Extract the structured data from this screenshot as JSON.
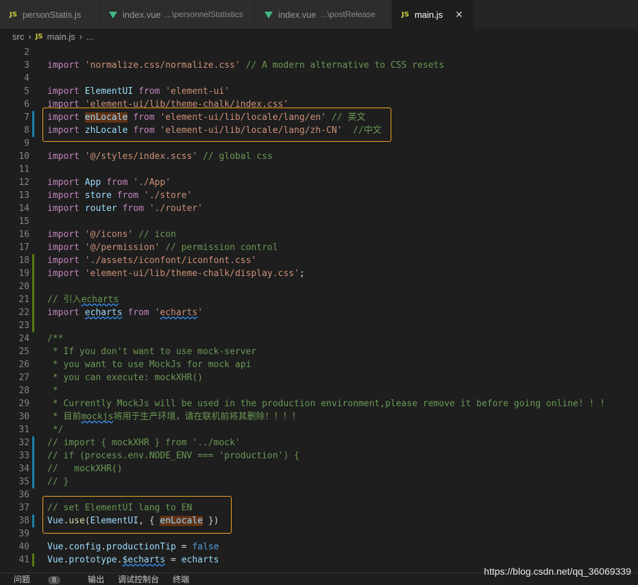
{
  "tabs": [
    {
      "label": "personStatis.js",
      "badge": "JS",
      "path": "",
      "active": false
    },
    {
      "label": "index.vue",
      "badge": "vue",
      "path": "...\\personnelStatistics",
      "active": false
    },
    {
      "label": "index.vue",
      "badge": "vue",
      "path": "...\\postRelease",
      "active": false
    },
    {
      "label": "main.js",
      "badge": "JS",
      "path": "",
      "active": true,
      "close": "✕"
    }
  ],
  "breadcrumb": {
    "folder": "src",
    "file_badge": "JS",
    "file": "main.js",
    "more": "..."
  },
  "lines": [
    {
      "n": "2",
      "mark": "",
      "parts": []
    },
    {
      "n": "3",
      "mark": "",
      "parts": [
        [
          "kw",
          "import "
        ],
        [
          "str",
          "'normalize.css/normalize.css'"
        ],
        [
          "op",
          " "
        ],
        [
          "cm",
          "// A modern alternative to CSS resets"
        ]
      ]
    },
    {
      "n": "4",
      "mark": "",
      "parts": []
    },
    {
      "n": "5",
      "mark": "",
      "parts": [
        [
          "kw",
          "import "
        ],
        [
          "var",
          "ElementUI"
        ],
        [
          "kw",
          " from "
        ],
        [
          "str",
          "'element-ui'"
        ]
      ]
    },
    {
      "n": "6",
      "mark": "",
      "parts": [
        [
          "kw",
          "import "
        ],
        [
          "str",
          "'element-ui/lib/theme-chalk/index.css'"
        ]
      ]
    },
    {
      "n": "7",
      "mark": "mod",
      "parts": [
        [
          "kw",
          "import "
        ],
        [
          "var hl",
          "enLocale"
        ],
        [
          "kw",
          " from "
        ],
        [
          "str",
          "'element-ui/lib/locale/lang/en'"
        ],
        [
          "op",
          " "
        ],
        [
          "cm",
          "// 英文"
        ]
      ]
    },
    {
      "n": "8",
      "mark": "mod",
      "parts": [
        [
          "kw",
          "import "
        ],
        [
          "var",
          "zhLocale"
        ],
        [
          "kw",
          " from "
        ],
        [
          "str",
          "'element-ui/lib/locale/lang/zh-CN'"
        ],
        [
          "op",
          "  "
        ],
        [
          "cm",
          "//中文"
        ]
      ]
    },
    {
      "n": "9",
      "mark": "",
      "parts": []
    },
    {
      "n": "10",
      "mark": "",
      "parts": [
        [
          "kw",
          "import "
        ],
        [
          "str",
          "'@/styles/index.scss'"
        ],
        [
          "op",
          " "
        ],
        [
          "cm",
          "// global css"
        ]
      ]
    },
    {
      "n": "11",
      "mark": "",
      "parts": []
    },
    {
      "n": "12",
      "mark": "",
      "parts": [
        [
          "kw",
          "import "
        ],
        [
          "var",
          "App"
        ],
        [
          "kw",
          " from "
        ],
        [
          "str",
          "'./App'"
        ]
      ]
    },
    {
      "n": "13",
      "mark": "",
      "parts": [
        [
          "kw",
          "import "
        ],
        [
          "var",
          "store"
        ],
        [
          "kw",
          " from "
        ],
        [
          "str",
          "'./store'"
        ]
      ]
    },
    {
      "n": "14",
      "mark": "",
      "parts": [
        [
          "kw",
          "import "
        ],
        [
          "var",
          "router"
        ],
        [
          "kw",
          " from "
        ],
        [
          "str",
          "'./router'"
        ]
      ]
    },
    {
      "n": "15",
      "mark": "",
      "parts": []
    },
    {
      "n": "16",
      "mark": "",
      "parts": [
        [
          "kw",
          "import "
        ],
        [
          "str",
          "'@/icons'"
        ],
        [
          "op",
          " "
        ],
        [
          "cm",
          "// icon"
        ]
      ]
    },
    {
      "n": "17",
      "mark": "",
      "parts": [
        [
          "kw",
          "import "
        ],
        [
          "str",
          "'@/permission'"
        ],
        [
          "op",
          " "
        ],
        [
          "cm",
          "// permission control"
        ]
      ]
    },
    {
      "n": "18",
      "mark": "add",
      "parts": [
        [
          "kw",
          "import "
        ],
        [
          "str",
          "'./assets/iconfont/iconfont.css'"
        ]
      ]
    },
    {
      "n": "19",
      "mark": "add",
      "parts": [
        [
          "kw",
          "import "
        ],
        [
          "str",
          "'element-ui/lib/theme-chalk/display.css'"
        ],
        [
          "op",
          ";"
        ]
      ]
    },
    {
      "n": "20",
      "mark": "add",
      "parts": []
    },
    {
      "n": "21",
      "mark": "add",
      "parts": [
        [
          "cm",
          "// 引入"
        ],
        [
          "cm squig",
          "echarts"
        ]
      ]
    },
    {
      "n": "22",
      "mark": "add",
      "parts": [
        [
          "kw",
          "import "
        ],
        [
          "var squig",
          "echarts"
        ],
        [
          "kw",
          " from "
        ],
        [
          "str",
          "'"
        ],
        [
          "str squig",
          "echarts"
        ],
        [
          "str",
          "'"
        ]
      ]
    },
    {
      "n": "23",
      "mark": "add",
      "parts": []
    },
    {
      "n": "24",
      "mark": "",
      "parts": [
        [
          "cm",
          "/**"
        ]
      ]
    },
    {
      "n": "25",
      "mark": "",
      "parts": [
        [
          "cm",
          " * If you don't want to use mock-server"
        ]
      ]
    },
    {
      "n": "26",
      "mark": "",
      "parts": [
        [
          "cm",
          " * you want to use MockJs for mock api"
        ]
      ]
    },
    {
      "n": "27",
      "mark": "",
      "parts": [
        [
          "cm",
          " * you can execute: mockXHR()"
        ]
      ]
    },
    {
      "n": "28",
      "mark": "",
      "parts": [
        [
          "cm",
          " *"
        ]
      ]
    },
    {
      "n": "29",
      "mark": "",
      "parts": [
        [
          "cm",
          " * Currently MockJs will be used in the production environment,please remove it before going online! ! !"
        ]
      ]
    },
    {
      "n": "30",
      "mark": "",
      "parts": [
        [
          "cm",
          " * 目前"
        ],
        [
          "cm squig",
          "mockjs"
        ],
        [
          "cm",
          "将用于生产环境，请在联机前将其删除！！！！"
        ]
      ]
    },
    {
      "n": "31",
      "mark": "",
      "parts": [
        [
          "cm",
          " */"
        ]
      ]
    },
    {
      "n": "32",
      "mark": "mod",
      "parts": [
        [
          "cm",
          "// import { mockXHR } from '../mock'"
        ]
      ]
    },
    {
      "n": "33",
      "mark": "mod",
      "parts": [
        [
          "cm",
          "// if (process.env.NODE_ENV === 'production') {"
        ]
      ]
    },
    {
      "n": "34",
      "mark": "mod",
      "parts": [
        [
          "cm",
          "//   mockXHR()"
        ]
      ]
    },
    {
      "n": "35",
      "mark": "mod",
      "parts": [
        [
          "cm",
          "// }"
        ]
      ]
    },
    {
      "n": "36",
      "mark": "",
      "parts": []
    },
    {
      "n": "37",
      "mark": "",
      "parts": [
        [
          "cm",
          "// set ElementUI lang to EN"
        ]
      ]
    },
    {
      "n": "38",
      "mark": "mod",
      "parts": [
        [
          "var",
          "Vue"
        ],
        [
          "op",
          "."
        ],
        [
          "fn",
          "use"
        ],
        [
          "op",
          "("
        ],
        [
          "var",
          "ElementUI"
        ],
        [
          "op",
          ", { "
        ],
        [
          "var hl",
          "enLocale"
        ],
        [
          "op",
          " })"
        ]
      ]
    },
    {
      "n": "39",
      "mark": "",
      "parts": []
    },
    {
      "n": "40",
      "mark": "",
      "parts": [
        [
          "var",
          "Vue"
        ],
        [
          "op",
          "."
        ],
        [
          "var",
          "config"
        ],
        [
          "op",
          "."
        ],
        [
          "var",
          "productionTip"
        ],
        [
          "op",
          " = "
        ],
        [
          "const",
          "false"
        ]
      ]
    },
    {
      "n": "41",
      "mark": "add",
      "parts": [
        [
          "var",
          "Vue"
        ],
        [
          "op",
          "."
        ],
        [
          "var",
          "prototype"
        ],
        [
          "op",
          "."
        ],
        [
          "var squig",
          "$echarts"
        ],
        [
          "op",
          " = "
        ],
        [
          "var",
          "echarts"
        ]
      ]
    }
  ],
  "panel": {
    "problems": "问题",
    "problems_count": "8",
    "output": "输出",
    "debug_console": "调试控制台",
    "terminal": "终端"
  },
  "watermark": "https://blog.csdn.net/qq_36069339"
}
